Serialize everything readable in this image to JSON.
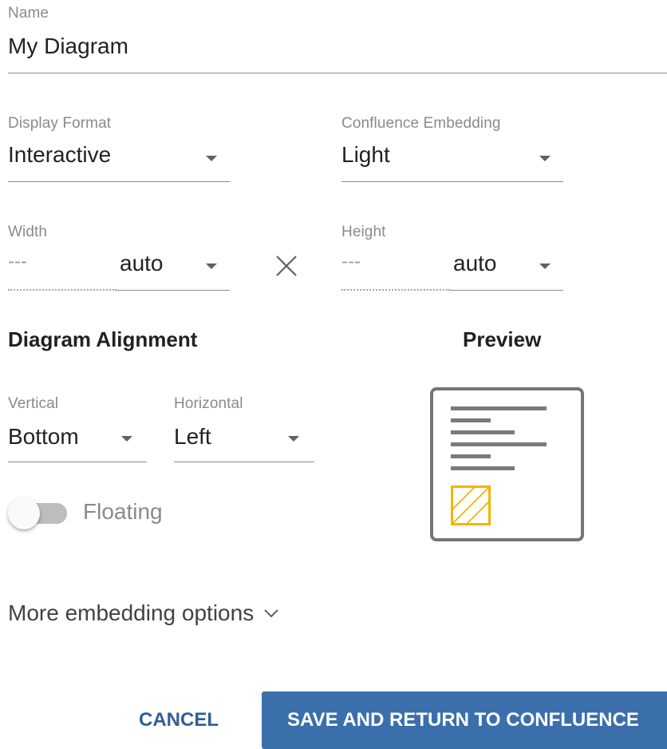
{
  "name_field": {
    "label": "Name",
    "value": "My Diagram"
  },
  "display_format": {
    "label": "Display Format",
    "value": "Interactive"
  },
  "confluence_embedding": {
    "label": "Confluence Embedding",
    "value": "Light"
  },
  "width": {
    "label": "Width",
    "placeholder": "---",
    "unit": "auto"
  },
  "height": {
    "label": "Height",
    "placeholder": "---",
    "unit": "auto"
  },
  "dimension_separator_icon": "close-icon",
  "alignment": {
    "heading": "Diagram Alignment",
    "vertical": {
      "label": "Vertical",
      "value": "Bottom"
    },
    "horizontal": {
      "label": "Horizontal",
      "value": "Left"
    }
  },
  "floating": {
    "label": "Floating",
    "on": false
  },
  "preview": {
    "heading": "Preview",
    "accent_color": "#f5b400"
  },
  "more_options": {
    "label": "More embedding options",
    "icon": "chevron-down-icon"
  },
  "actions": {
    "cancel_label": "CANCEL",
    "save_label": "SAVE AND RETURN TO CONFLUENCE",
    "primary_color": "#3a6fab"
  }
}
